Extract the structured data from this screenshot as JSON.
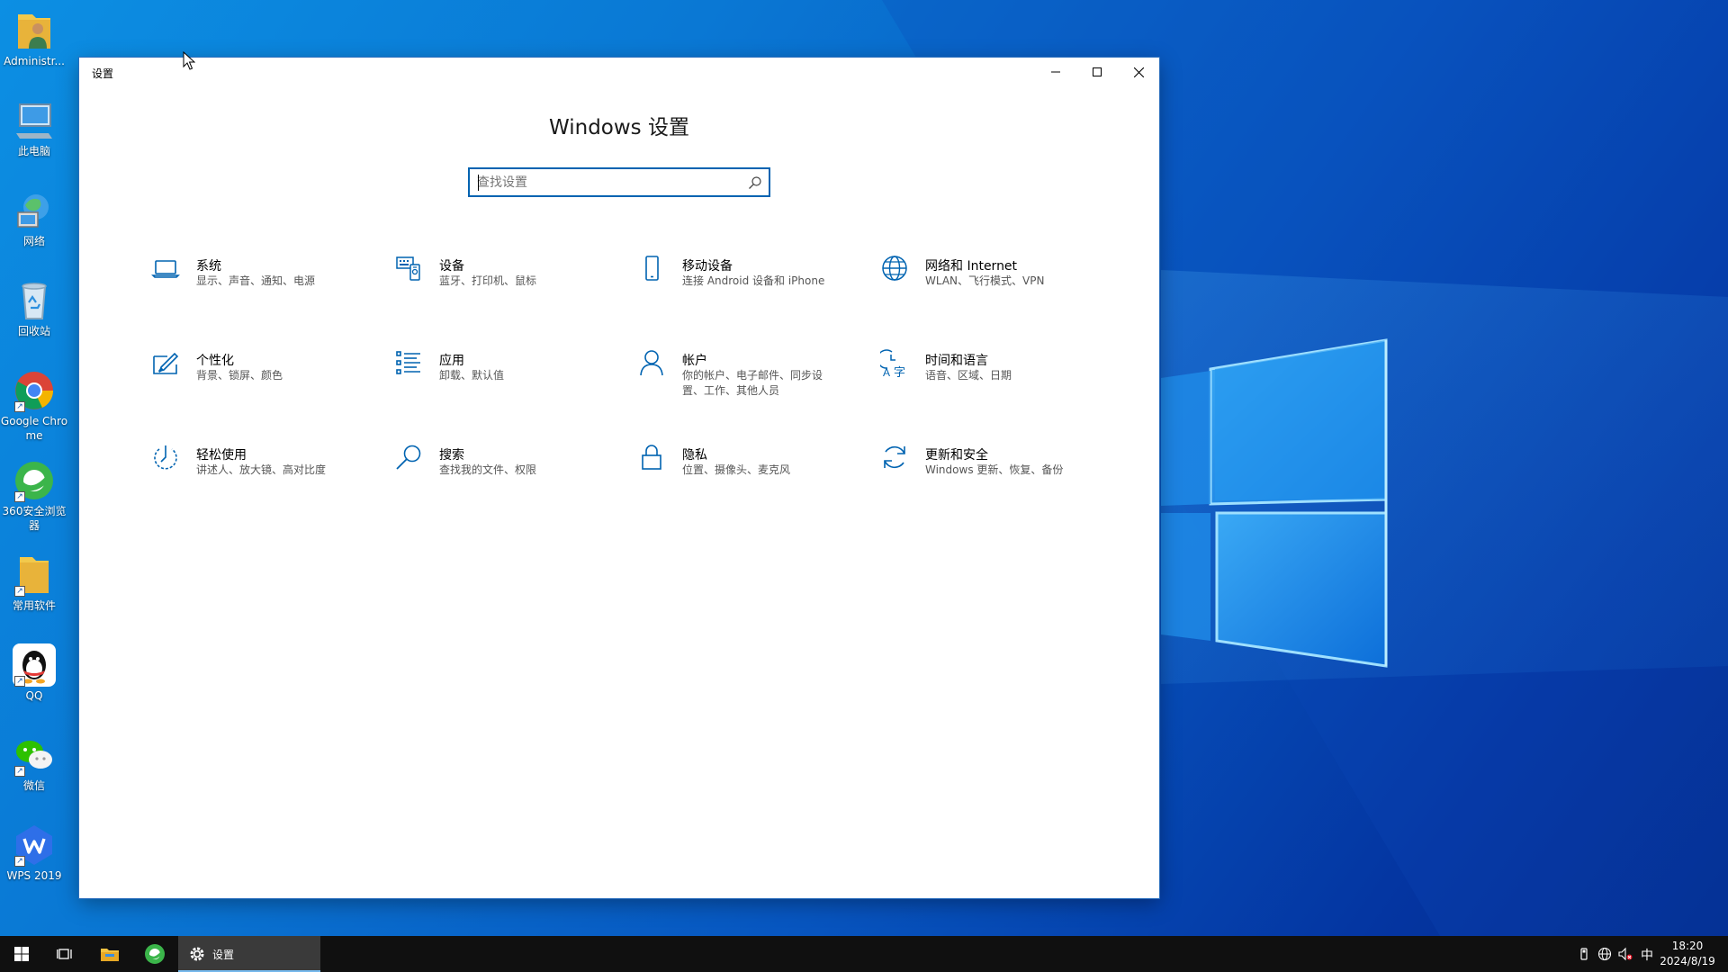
{
  "desktop": {
    "icons": [
      {
        "label": "Administr...",
        "icon": "user-folder-icon"
      },
      {
        "label": "此电脑",
        "icon": "computer-icon"
      },
      {
        "label": "网络",
        "icon": "network-globe-icon"
      },
      {
        "label": "回收站",
        "icon": "recycle-bin-icon"
      },
      {
        "label": "Google Chrome",
        "icon": "chrome-icon"
      },
      {
        "label": "360安全浏览器",
        "icon": "360-browser-icon"
      },
      {
        "label": "常用软件",
        "icon": "folder-icon"
      },
      {
        "label": "QQ",
        "icon": "qq-penguin-icon"
      },
      {
        "label": "微信",
        "icon": "wechat-icon"
      },
      {
        "label": "WPS 2019",
        "icon": "wps-icon"
      }
    ]
  },
  "window": {
    "title": "设置",
    "heading": "Windows 设置",
    "search": {
      "placeholder": "查找设置",
      "value": ""
    }
  },
  "categories": [
    {
      "name": "系统",
      "desc": "显示、声音、通知、电源",
      "icon": "laptop-icon"
    },
    {
      "name": "设备",
      "desc": "蓝牙、打印机、鼠标",
      "icon": "devices-keyboard-icon"
    },
    {
      "name": "移动设备",
      "desc": "连接 Android 设备和 iPhone",
      "icon": "phone-icon"
    },
    {
      "name": "网络和 Internet",
      "desc": "WLAN、飞行模式、VPN",
      "icon": "globe-icon"
    },
    {
      "name": "个性化",
      "desc": "背景、锁屏、颜色",
      "icon": "personalization-pen-icon"
    },
    {
      "name": "应用",
      "desc": "卸载、默认值",
      "icon": "apps-list-icon"
    },
    {
      "name": "帐户",
      "desc": "你的帐户、电子邮件、同步设置、工作、其他人员",
      "icon": "person-icon"
    },
    {
      "name": "时间和语言",
      "desc": "语音、区域、日期",
      "icon": "time-language-icon"
    },
    {
      "name": "轻松使用",
      "desc": "讲述人、放大镜、高对比度",
      "icon": "ease-of-access-icon"
    },
    {
      "name": "搜索",
      "desc": "查找我的文件、权限",
      "icon": "search-magnifier-icon"
    },
    {
      "name": "隐私",
      "desc": "位置、摄像头、麦克风",
      "icon": "lock-icon"
    },
    {
      "name": "更新和安全",
      "desc": "Windows 更新、恢复、备份",
      "icon": "update-sync-icon"
    }
  ],
  "taskbar": {
    "running_app": "设置",
    "ime": "中",
    "time": "18:20",
    "date": "2024/8/19"
  },
  "colors": {
    "accent": "#0063b1",
    "icon_blue": "#0063b1",
    "taskbar": "#101010"
  }
}
